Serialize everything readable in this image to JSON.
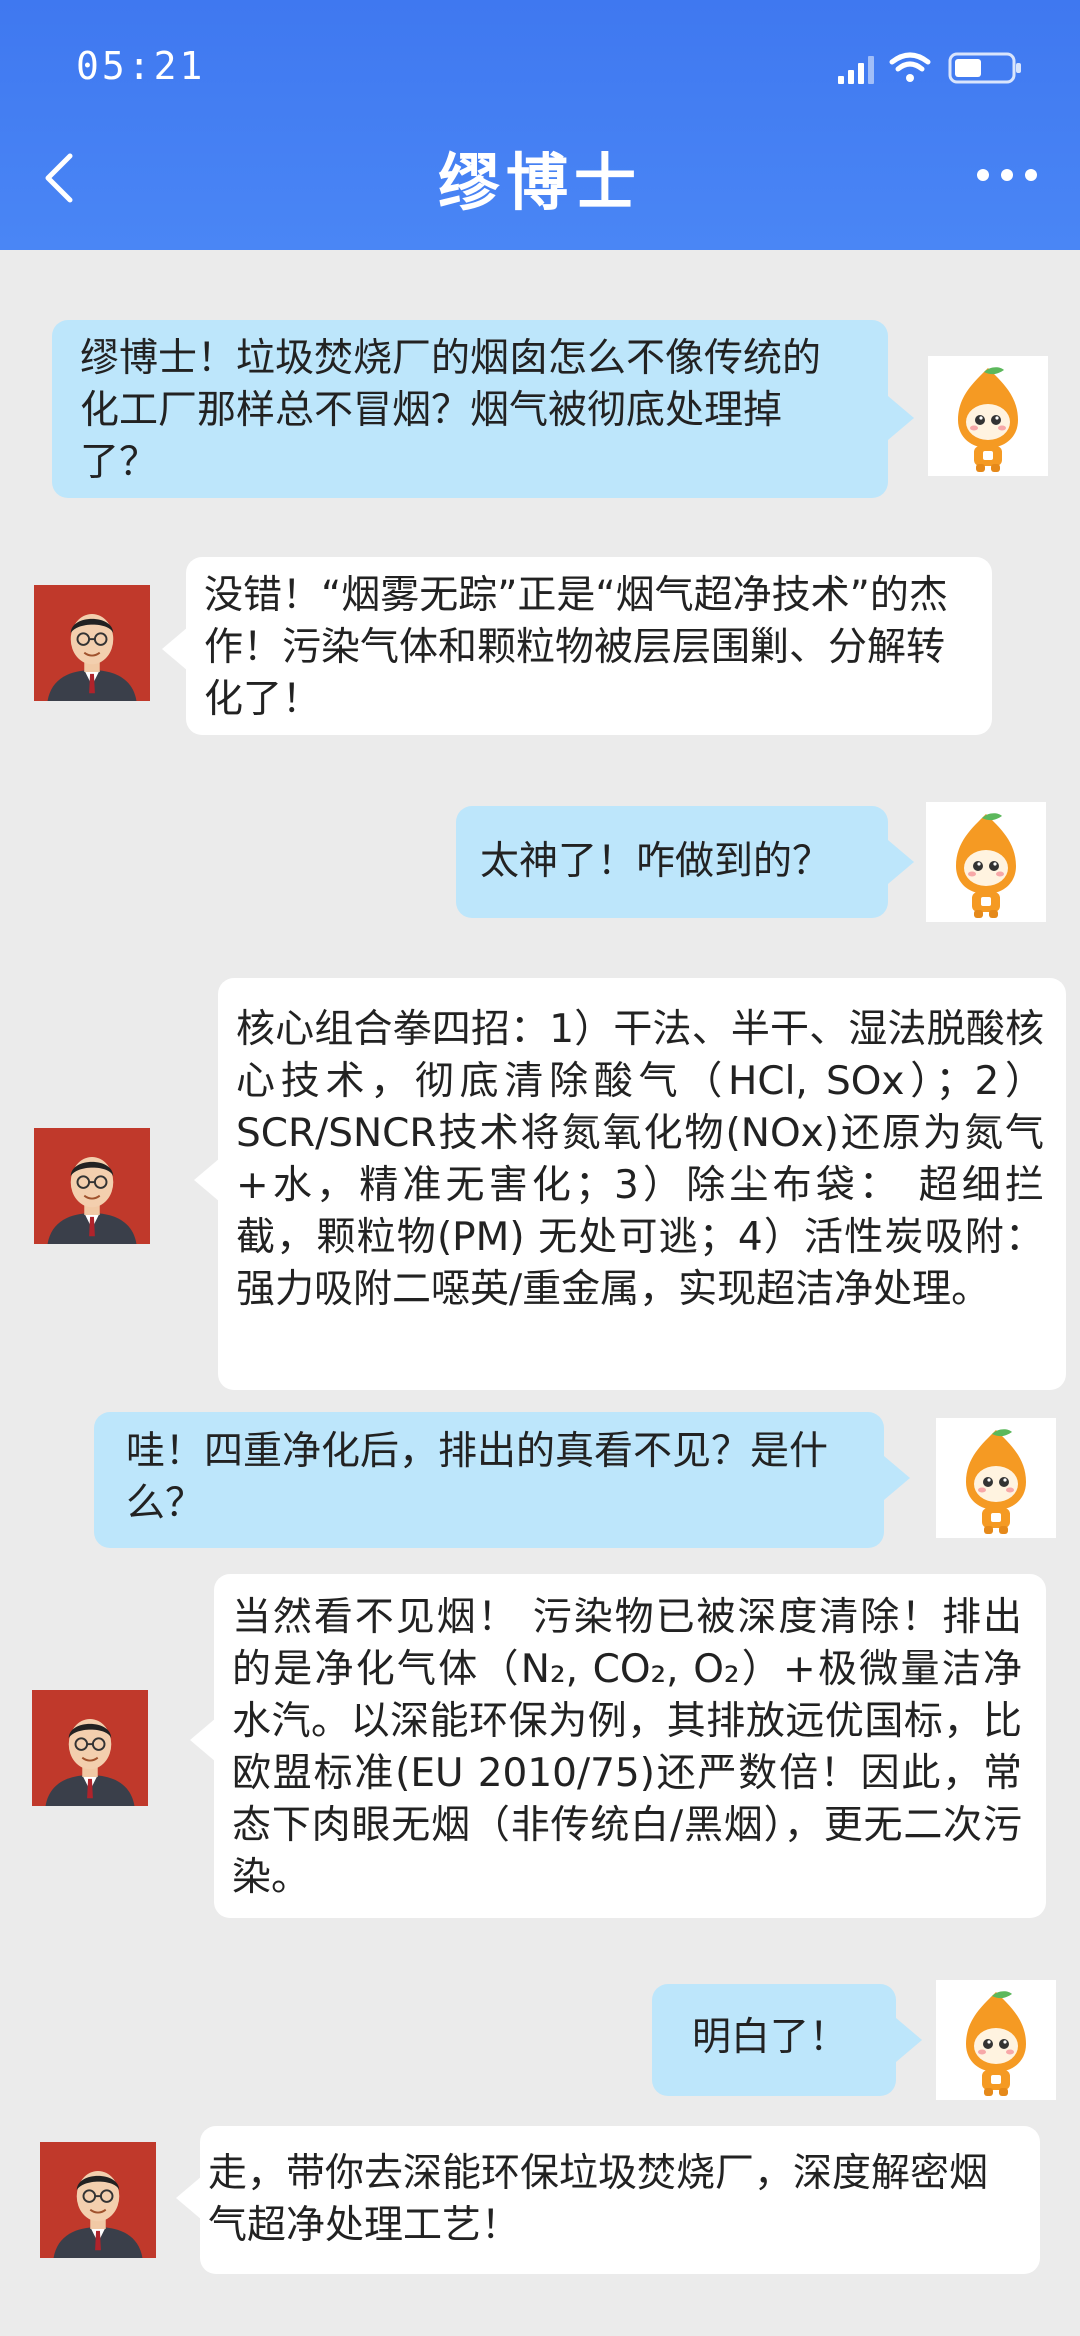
{
  "status_bar": {
    "time": "05:21"
  },
  "header": {
    "title": "缪博士"
  },
  "messages": [
    {
      "sender": "user",
      "text": "缪博士！垃圾焚烧厂的烟囱怎么不像传统的化工厂那样总不冒烟？烟气被彻底处理掉了？"
    },
    {
      "sender": "doctor",
      "text": "没错！“烟雾无踪”正是“烟气超净技术”的杰作！污染气体和颗粒物被层层围剿、分解转化了！"
    },
    {
      "sender": "user",
      "text": "太神了！咋做到的？"
    },
    {
      "sender": "doctor",
      "text": "核心组合拳四招：1）干法、半干、湿法脱酸核心技术，彻底清除酸气（HCl, SOx）；2） SCR/SNCR技术将氮氧化物(NOx)还原为氮气+水，精准无害化；3）除尘布袋： 超细拦截，颗粒物(PM) 无处可逃；4）活性炭吸附： 强力吸附二噁英/重金属，实现超洁净处理。"
    },
    {
      "sender": "user",
      "text": "哇！四重净化后，排出的真看不见？是什么？"
    },
    {
      "sender": "doctor",
      "text": "当然看不见烟！ 污染物已被深度清除！排出的是净化气体（N₂, CO₂, O₂）+极微量洁净水汽。以深能环保为例，其排放远优国标，比欧盟标准(EU 2010/75)还严数倍！因此，常态下肉眼无烟（非传统白/黑烟），更无二次污染。"
    },
    {
      "sender": "user",
      "text": "明白了！"
    },
    {
      "sender": "doctor",
      "text": "走，带你去深能环保垃圾焚烧厂，深度解密烟气超净处理工艺！"
    }
  ],
  "colors": {
    "header": "#4a86f5",
    "user_bubble": "#bde6fb",
    "doctor_bubble": "#ffffff",
    "background": "#ebebeb"
  }
}
